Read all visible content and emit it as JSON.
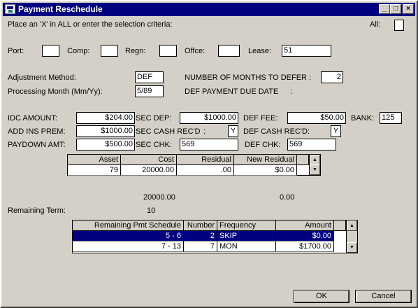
{
  "window": {
    "title": "Payment Reschedule",
    "minimize": "_",
    "maximize": "□",
    "close": "×"
  },
  "selection": {
    "instruction": "Place an 'X' in ALL or enter the selection criteria:",
    "all_label": "All:",
    "all_value": "",
    "port_label": "Port:",
    "port_value": "",
    "comp_label": "Comp:",
    "comp_value": "",
    "regn_label": "Regn:",
    "regn_value": "",
    "offce_label": "Offce:",
    "offce_value": "",
    "lease_label": "Lease:",
    "lease_value": "51"
  },
  "adjustment": {
    "method_label": "Adjustment Method:",
    "method_value": "DEF",
    "processing_label": "Processing Month (Mm/Yy):",
    "processing_value": "5/89",
    "months_defer_label": "NUMBER OF MONTHS TO DEFER :",
    "months_defer_value": "2",
    "def_due_label": "DEF PAYMENT DUE DATE",
    "def_due_colon": ":"
  },
  "amounts": {
    "idc_label": "IDC AMOUNT:",
    "idc_value": "$204.00",
    "sec_dep_label": "SEC DEP:",
    "sec_dep_value": "$1000.00",
    "def_fee_label": "DEF FEE:",
    "def_fee_value": "$50.00",
    "bank_label": "BANK:",
    "bank_value": "125",
    "add_ins_label": "ADD INS PREM:",
    "add_ins_value": "$1000.00",
    "sec_cash_label": "SEC CASH REC'D",
    "sec_cash_colon": ":",
    "sec_cash_value": "Y",
    "def_cash_label": "DEF CASH REC'D:",
    "def_cash_value": "Y",
    "paydown_label": "PAYDOWN AMT:",
    "paydown_value": "$500.00",
    "sec_chk_label": "SEC CHK:",
    "sec_chk_value": "569",
    "def_chk_label": "DEF CHK:",
    "def_chk_value": "569"
  },
  "asset_grid": {
    "headers": [
      "Asset",
      "Cost",
      "Residual",
      "New Residual"
    ],
    "row": [
      "79",
      "20000.00",
      ".00",
      "$0.00"
    ],
    "total_cost": "20000.00",
    "total_new_residual": "0.00"
  },
  "remaining": {
    "label": "Remaining Term:",
    "value": "10"
  },
  "schedule_grid": {
    "headers": [
      "Remaining Pmt Schedule",
      "Number",
      "Frequency",
      "Amount"
    ],
    "rows": [
      [
        "5 -  6",
        "2",
        "SKIP",
        "$0.00"
      ],
      [
        "7 - 13",
        "7",
        "MON",
        "$1700.00"
      ]
    ]
  },
  "buttons": {
    "ok": "OK",
    "cancel": "Cancel"
  },
  "colors": {
    "title_bar": "#000080",
    "selected_row": "#000080",
    "face": "#d4d0c8"
  }
}
